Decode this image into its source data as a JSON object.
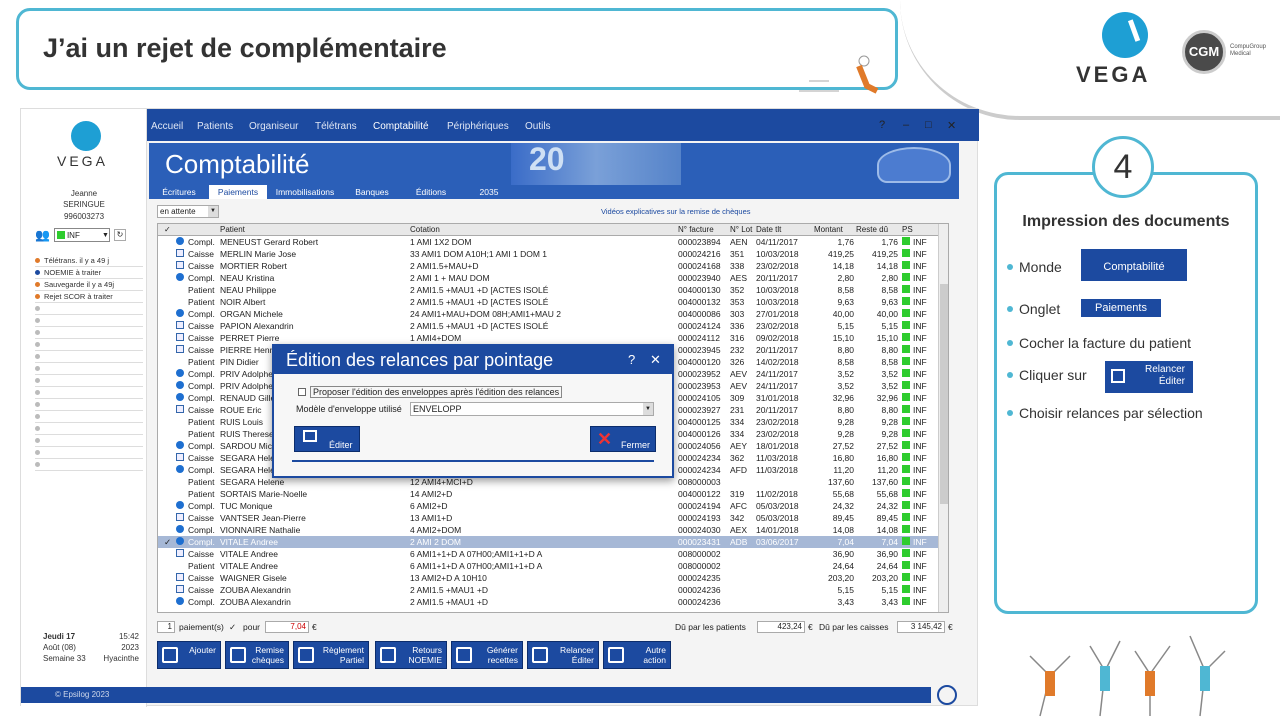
{
  "slide": {
    "title": "J’ai un rejet de complémentaire",
    "brand": "VEGA",
    "partner_logo": "CGM",
    "partner_sub": "CompuGroup Medical"
  },
  "app": {
    "logo": "VEGA",
    "user": {
      "first": "Jeanne",
      "last": "SERINGUE",
      "id": "996003273"
    },
    "status_value": "INF",
    "sidebar_items": [
      {
        "label": "Télétrans. il y a 49 j",
        "color": "#e07a2a"
      },
      {
        "label": "NOEMIE à traiter",
        "color": "#1c4aa0"
      },
      {
        "label": "Sauvegarde il y a 49j",
        "color": "#e07a2a"
      },
      {
        "label": "Rejet SCOR à traiter",
        "color": "#e07a2a"
      }
    ],
    "date": {
      "day": "Jeudi 17",
      "time": "15:42",
      "month": "Août (08)",
      "year": "2023",
      "week": "Semaine 33",
      "saint": "Hyacinthe"
    },
    "menu": [
      "Accueil",
      "Patients",
      "Organiseur",
      "Télétrans",
      "Comptabilité",
      "Périphériques",
      "Outils"
    ],
    "window_controls": [
      "?",
      "–",
      "□",
      "✕"
    ],
    "module_title": "Comptabilité",
    "banknote_value": "20",
    "tabs": [
      "Écritures",
      "Paiements",
      "Immobilisations",
      "Banques",
      "Éditions",
      "2035"
    ],
    "filter_value": "en attente",
    "video_link": "Vidéos explicatives sur la remise de chèques",
    "columns": [
      "Patient",
      "Cotation",
      "N° facture",
      "N° Lot",
      "Date tlt",
      "Montant",
      "Reste dû",
      "PS"
    ],
    "rows": [
      {
        "t": "Compl.",
        "p": "MENEUST Gerard Robert",
        "c": "1 AMI 1X2 DOM",
        "f": "000023894",
        "l": "AEN",
        "d": "04/11/2017",
        "m": "1,76",
        "r": "1,76",
        "ps": "INF",
        "i": "c"
      },
      {
        "t": "Caisse",
        "p": "MERLIN Marie Jose",
        "c": "33 AMI1 DOM A10H;1 AMI 1 DOM 1",
        "f": "000024216",
        "l": "351",
        "d": "10/03/2018",
        "m": "419,25",
        "r": "419,25",
        "ps": "INF",
        "i": "k"
      },
      {
        "t": "Caisse",
        "p": "MORTIER Robert",
        "c": "2 AMI1.5+MAU+D",
        "f": "000024168",
        "l": "338",
        "d": "23/02/2018",
        "m": "14,18",
        "r": "14,18",
        "ps": "INF",
        "i": "k"
      },
      {
        "t": "Compl.",
        "p": "NEAU Kristina",
        "c": "2 AMI 1 + MAU DOM",
        "f": "000023940",
        "l": "AES",
        "d": "20/11/2017",
        "m": "2,80",
        "r": "2,80",
        "ps": "INF",
        "i": "c"
      },
      {
        "t": "Patient",
        "p": "NEAU Philippe",
        "c": "2 AMI1.5 +MAU1 +D [ACTES ISOLÉ",
        "f": "004000130",
        "l": "352",
        "d": "10/03/2018",
        "m": "8,58",
        "r": "8,58",
        "ps": "INF",
        "i": ""
      },
      {
        "t": "Patient",
        "p": "NOIR Albert",
        "c": "2 AMI1.5 +MAU1 +D [ACTES ISOLÉ",
        "f": "004000132",
        "l": "353",
        "d": "10/03/2018",
        "m": "9,63",
        "r": "9,63",
        "ps": "INF",
        "i": ""
      },
      {
        "t": "Compl.",
        "p": "ORGAN Michele",
        "c": "24 AMI1+MAU+DOM 08H;AMI1+MAU 2",
        "f": "004000086",
        "l": "303",
        "d": "27/01/2018",
        "m": "40,00",
        "r": "40,00",
        "ps": "INF",
        "i": "c"
      },
      {
        "t": "Caisse",
        "p": "PAPION Alexandrin",
        "c": "2 AMI1.5 +MAU1 +D [ACTES ISOLÉ",
        "f": "000024124",
        "l": "336",
        "d": "23/02/2018",
        "m": "5,15",
        "r": "5,15",
        "ps": "INF",
        "i": "k"
      },
      {
        "t": "Caisse",
        "p": "PERRET Pierre",
        "c": "1 AMI4+DOM",
        "f": "000024112",
        "l": "316",
        "d": "09/02/2018",
        "m": "15,10",
        "r": "15,10",
        "ps": "INF",
        "i": "k"
      },
      {
        "t": "Caisse",
        "p": "PIERRE Henri",
        "c": "",
        "f": "000023945",
        "l": "232",
        "d": "20/11/2017",
        "m": "8,80",
        "r": "8,80",
        "ps": "INF",
        "i": "k"
      },
      {
        "t": "Patient",
        "p": "PIN Didier",
        "c": "",
        "f": "004000120",
        "l": "326",
        "d": "14/02/2018",
        "m": "8,58",
        "r": "8,58",
        "ps": "INF",
        "i": ""
      },
      {
        "t": "Compl.",
        "p": "PRIV Adolphe",
        "c": "",
        "f": "000023952",
        "l": "AEV",
        "d": "24/11/2017",
        "m": "3,52",
        "r": "3,52",
        "ps": "INF",
        "i": "c"
      },
      {
        "t": "Compl.",
        "p": "PRIV Adolphe",
        "c": "",
        "f": "000023953",
        "l": "AEV",
        "d": "24/11/2017",
        "m": "3,52",
        "r": "3,52",
        "ps": "INF",
        "i": "c"
      },
      {
        "t": "Compl.",
        "p": "RENAUD Gilles",
        "c": "",
        "f": "000024105",
        "l": "309",
        "d": "31/01/2018",
        "m": "32,96",
        "r": "32,96",
        "ps": "INF",
        "i": "c"
      },
      {
        "t": "Caisse",
        "p": "ROUE Eric",
        "c": "",
        "f": "000023927",
        "l": "231",
        "d": "20/11/2017",
        "m": "8,80",
        "r": "8,80",
        "ps": "INF",
        "i": "k"
      },
      {
        "t": "Patient",
        "p": "RUIS Louis",
        "c": "",
        "f": "004000125",
        "l": "334",
        "d": "23/02/2018",
        "m": "9,28",
        "r": "9,28",
        "ps": "INF",
        "i": ""
      },
      {
        "t": "Patient",
        "p": "RUIS Therese",
        "c": "",
        "f": "004000126",
        "l": "334",
        "d": "23/02/2018",
        "m": "9,28",
        "r": "9,28",
        "ps": "INF",
        "i": ""
      },
      {
        "t": "Compl.",
        "p": "SARDOU Michel",
        "c": "",
        "f": "000024056",
        "l": "AEY",
        "d": "18/01/2018",
        "m": "27,52",
        "r": "27,52",
        "ps": "INF",
        "i": "c"
      },
      {
        "t": "Caisse",
        "p": "SEGARA Helene",
        "c": "",
        "f": "000024234",
        "l": "362",
        "d": "11/03/2018",
        "m": "16,80",
        "r": "16,80",
        "ps": "INF",
        "i": "k"
      },
      {
        "t": "Compl.",
        "p": "SEGARA Helene",
        "c": "",
        "f": "000024234",
        "l": "AFD",
        "d": "11/03/2018",
        "m": "11,20",
        "r": "11,20",
        "ps": "INF",
        "i": "c"
      },
      {
        "t": "Patient",
        "p": "SEGARA Helene",
        "c": "12 AMI4+MCI+D",
        "f": "008000003",
        "l": "",
        "d": "",
        "m": "137,60",
        "r": "137,60",
        "ps": "INF",
        "i": ""
      },
      {
        "t": "Patient",
        "p": "SORTAIS Marie-Noelle",
        "c": "14 AMI2+D",
        "f": "004000122",
        "l": "319",
        "d": "11/02/2018",
        "m": "55,68",
        "r": "55,68",
        "ps": "INF",
        "i": ""
      },
      {
        "t": "Compl.",
        "p": "TUC Monique",
        "c": "6 AMI2+D",
        "f": "000024194",
        "l": "AFC",
        "d": "05/03/2018",
        "m": "24,32",
        "r": "24,32",
        "ps": "INF",
        "i": "c"
      },
      {
        "t": "Caisse",
        "p": "VANTSER Jean-Pierre",
        "c": "13 AMI1+D",
        "f": "000024193",
        "l": "342",
        "d": "05/03/2018",
        "m": "89,45",
        "r": "89,45",
        "ps": "INF",
        "i": "k"
      },
      {
        "t": "Compl.",
        "p": "VIONNAIRE Nathalie",
        "c": "4 AMI2+DOM",
        "f": "000024030",
        "l": "AEX",
        "d": "14/01/2018",
        "m": "14,08",
        "r": "14,08",
        "ps": "INF",
        "i": "c"
      },
      {
        "t": "Compl.",
        "p": "VITALE Andree",
        "c": "2 AMI 2 DOM",
        "f": "000023431",
        "l": "ADB",
        "d": "03/06/2017",
        "m": "7,04",
        "r": "7,04",
        "ps": "INF",
        "i": "c",
        "sel": true
      },
      {
        "t": "Caisse",
        "p": "VITALE Andree",
        "c": "6 AMI1+1+D A 07H00;AMI1+1+D A",
        "f": "008000002",
        "l": "",
        "d": "",
        "m": "36,90",
        "r": "36,90",
        "ps": "INF",
        "i": "k"
      },
      {
        "t": "Patient",
        "p": "VITALE Andree",
        "c": "6 AMI1+1+D A 07H00;AMI1+1+D A",
        "f": "008000002",
        "l": "",
        "d": "",
        "m": "24,64",
        "r": "24,64",
        "ps": "INF",
        "i": ""
      },
      {
        "t": "Caisse",
        "p": "WAIGNER Gisele",
        "c": "13 AMI2+D A 10H10",
        "f": "000024235",
        "l": "",
        "d": "",
        "m": "203,20",
        "r": "203,20",
        "ps": "INF",
        "i": "k"
      },
      {
        "t": "Caisse",
        "p": "ZOUBA Alexandrin",
        "c": "2 AMI1.5 +MAU1 +D",
        "f": "000024236",
        "l": "",
        "d": "",
        "m": "5,15",
        "r": "5,15",
        "ps": "INF",
        "i": "k"
      },
      {
        "t": "Compl.",
        "p": "ZOUBA Alexandrin",
        "c": "2 AMI1.5 +MAU1 +D",
        "f": "000024236",
        "l": "",
        "d": "",
        "m": "3,43",
        "r": "3,43",
        "ps": "INF",
        "i": "c"
      }
    ],
    "footer": {
      "count": "1",
      "count_label": "paiement(s)",
      "pour_label": "pour",
      "amount": "7,04",
      "currency": "€",
      "patients_label": "Dû par les patients",
      "patients_value": "423,24",
      "caisses_label": "Dû par les caisses",
      "caisses_value": "3 145,42"
    },
    "actions": [
      {
        "l1": "",
        "l2": "Ajouter"
      },
      {
        "l1": "Remise",
        "l2": "chèques"
      },
      {
        "l1": "Règlement",
        "l2": "Partiel"
      },
      {
        "l1": "Retours",
        "l2": "NOEMIE"
      },
      {
        "l1": "Générer",
        "l2": "recettes"
      },
      {
        "l1": "Relancer",
        "l2": "Éditer"
      },
      {
        "l1": "Autre",
        "l2": "action"
      }
    ],
    "copyright": "© Epsilog 2023"
  },
  "dialog": {
    "title": "Édition des relances par pointage",
    "help": "?",
    "close": "✕",
    "checkbox_label": "Proposer l'édition des enveloppes après l'édition des relances",
    "model_label": "Modèle d'enveloppe utilisé",
    "model_value": "ENVELOPP",
    "edit_button": "Éditer",
    "close_button": "Fermer"
  },
  "card": {
    "step": "4",
    "title": "Impression des documents",
    "steps": [
      {
        "text": "Monde",
        "chip": "Comptabilité"
      },
      {
        "text": "Onglet",
        "chip": "Paiements"
      },
      {
        "text": "Cocher la facture du patient",
        "chip": ""
      },
      {
        "text": "Cliquer sur",
        "chip1": "Relancer",
        "chip2": "Éditer"
      },
      {
        "text": "Choisir relances par sélection",
        "chip": ""
      }
    ]
  }
}
